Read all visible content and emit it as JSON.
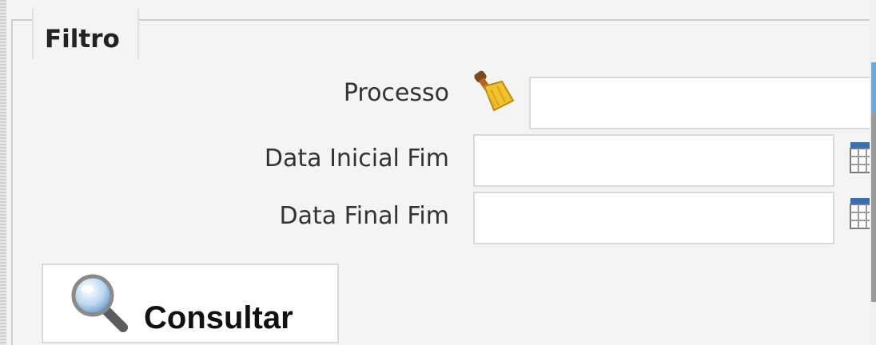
{
  "filter": {
    "legend": "Filtro",
    "fields": {
      "processo": {
        "label": "Processo",
        "value": "",
        "placeholder": ""
      },
      "data_inicial_fim": {
        "label": "Data Inicial Fim",
        "value": "",
        "placeholder": ""
      },
      "data_final_fim": {
        "label": "Data Final Fim",
        "value": "",
        "placeholder": ""
      }
    },
    "clear_icon": "broom-icon",
    "calendar_icon": "calendar-icon"
  },
  "actions": {
    "consultar_label": "Consultar",
    "consultar_icon": "magnifier-icon"
  },
  "colors": {
    "background": "#f4f4f4",
    "input_border": "#d9d9d9",
    "scroll_accent": "#6fa8dc"
  }
}
